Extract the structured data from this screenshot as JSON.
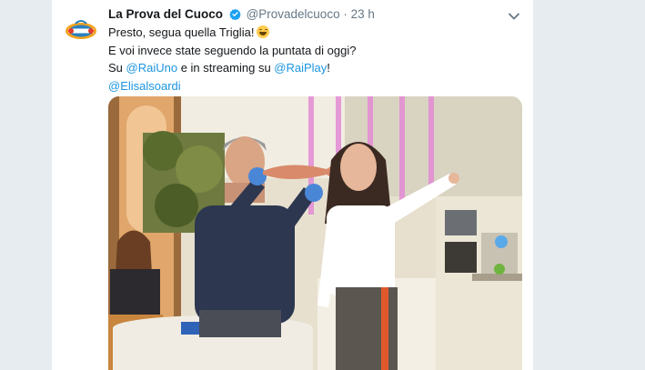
{
  "tweet": {
    "display_name": "La Prova del Cuoco",
    "handle": "@Provadelcuoco",
    "separator": "·",
    "time": "23 h",
    "verified": true,
    "lines": {
      "l1": "Presto, segua quella Triglia!",
      "l2": "E voi invece state seguendo la puntata di oggi?",
      "l3_pre": "Su ",
      "l3_m1": "@RaiUno",
      "l3_mid": " e in streaming su ",
      "l3_m2": "@RaiPlay",
      "l3_post": "!",
      "l4_m": "@Elisalsoardi"
    },
    "emoji": "grinning-face-icon",
    "media": "tv-studio-photo"
  },
  "colors": {
    "link": "#1b95e0",
    "text": "#14171a",
    "secondary": "#657786",
    "background": "#e6ecf0",
    "verified": "#1da1f2"
  }
}
